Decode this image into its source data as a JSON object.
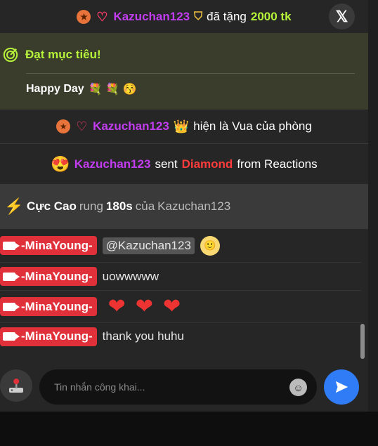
{
  "gift": {
    "user": "Kazuchan123",
    "text": "đã tặng",
    "amount": "2000 tk",
    "close_icon": "x-logo-icon"
  },
  "goal": {
    "title": "Đạt mục tiêu!",
    "message": "Happy Day",
    "emojis": "💐 💐 😚"
  },
  "king": {
    "user": "Kazuchan123",
    "text": "hiện là Vua của phòng",
    "crown": "👑"
  },
  "reaction": {
    "emoji": "😍",
    "user": "Kazuchan123",
    "sent": "sent",
    "item": "Diamond",
    "from": "from Reactions"
  },
  "vibrate": {
    "level": "Cực Cao",
    "rung": "rung",
    "duration": "180s",
    "of": "của",
    "user": "Kazuchan123"
  },
  "chat": {
    "rows": [
      {
        "sender": "-MinaYoung-",
        "mention": "@Kazuchan123",
        "text": "",
        "emoji": "🙂"
      },
      {
        "sender": "-MinaYoung-",
        "text": "uowwwww"
      },
      {
        "sender": "-MinaYoung-",
        "text": "",
        "hearts": "❤❤❤"
      },
      {
        "sender": "-MinaYoung-",
        "text": "thank you huhu"
      }
    ]
  },
  "composer": {
    "placeholder": "Tin nhắn công khai...",
    "send_icon": "send-arrow-icon"
  },
  "colors": {
    "accent_green": "#b6f23a",
    "username_purple": "#c23cf0",
    "badge_red": "#e0303a",
    "send_blue": "#2f7cf6"
  }
}
